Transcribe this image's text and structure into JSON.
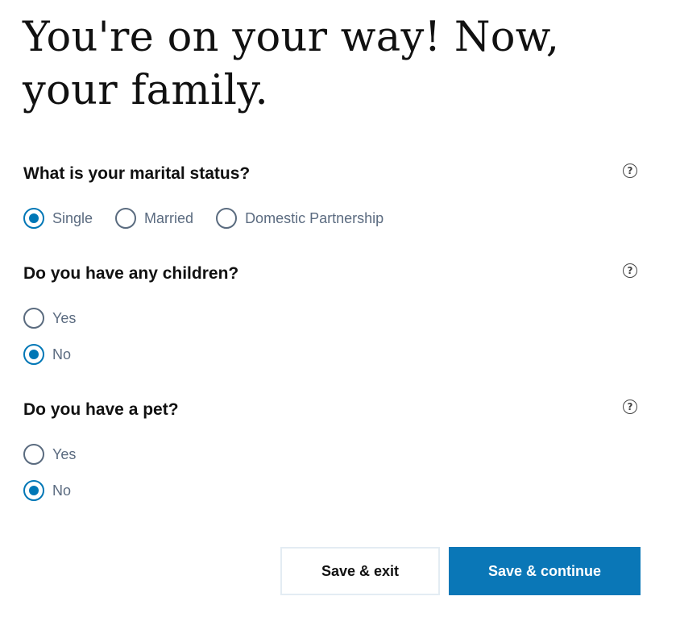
{
  "page": {
    "title": "You're on your way! Now, your family."
  },
  "questions": {
    "marital": {
      "label": "What is your marital status?",
      "help_icon": "question-circle-icon",
      "options": [
        "Single",
        "Married",
        "Domestic Partnership"
      ],
      "selected": "Single"
    },
    "children": {
      "label": "Do you have any children?",
      "help_icon": "question-circle-icon",
      "options": [
        "Yes",
        "No"
      ],
      "selected": "No"
    },
    "pet": {
      "label": "Do you have a pet?",
      "help_icon": "question-circle-icon",
      "options": [
        "Yes",
        "No"
      ],
      "selected": "No"
    }
  },
  "actions": {
    "save_exit_label": "Save & exit",
    "save_continue_label": "Save & continue"
  },
  "colors": {
    "accent": "#0a77b7",
    "radio_border": "#5a6b7f",
    "option_text": "#5b6b80"
  }
}
